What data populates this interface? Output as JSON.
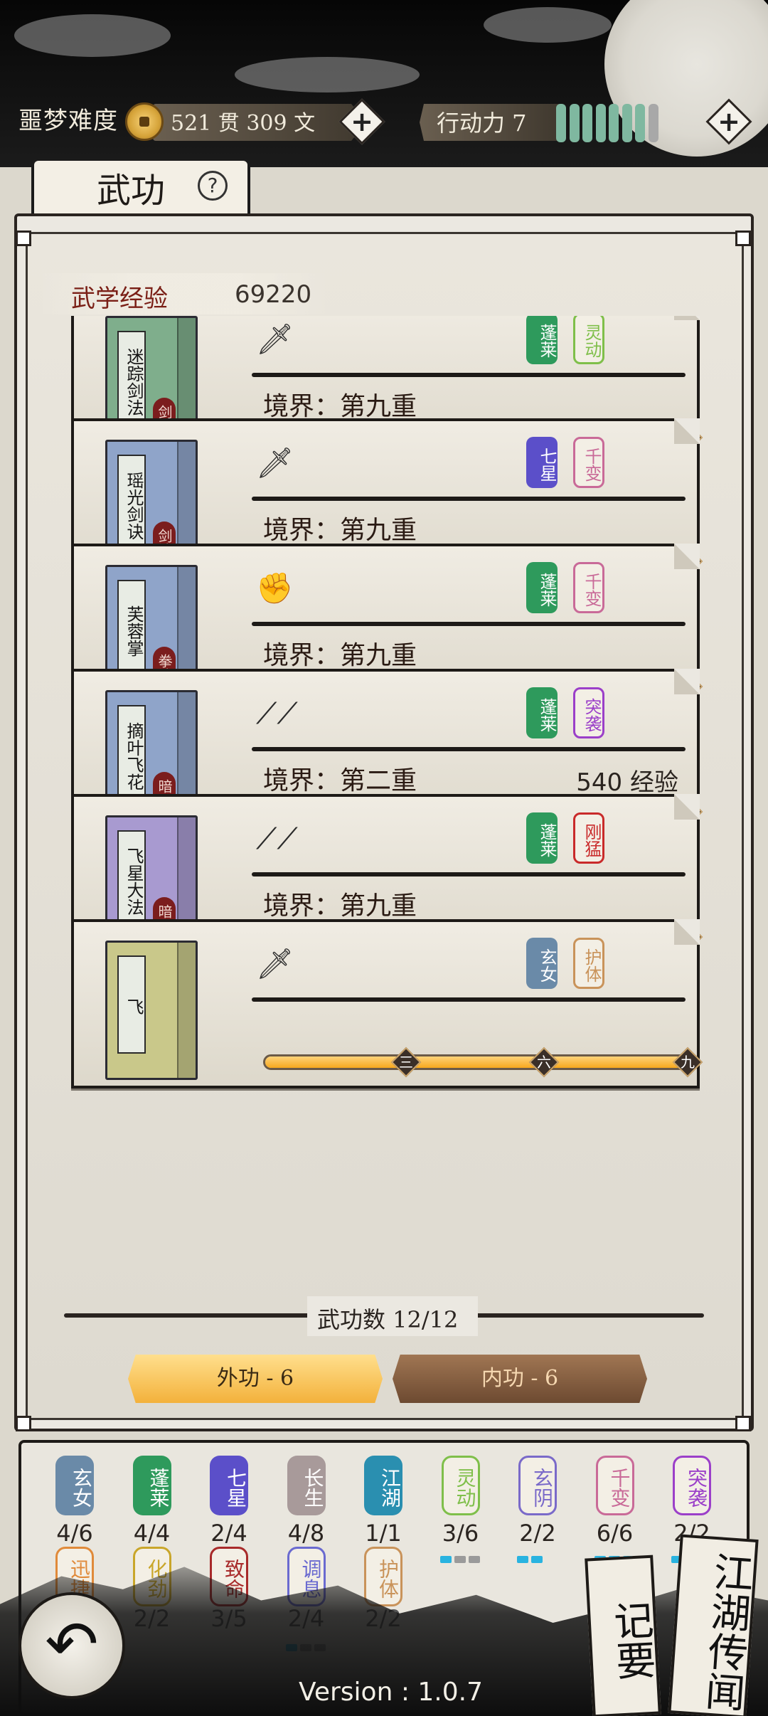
{
  "header": {
    "difficulty": "噩梦难度",
    "money": "521  贯   309   文",
    "action_label": "行动力 7",
    "action_points": 7,
    "action_max": 8
  },
  "panel": {
    "title": "武功",
    "help": "?",
    "exp_label": "武学经验",
    "exp_value": "69220"
  },
  "skills": [
    {
      "name": "迷踪剑法",
      "type": "剑法",
      "book_color": "#7fae8c",
      "weapon": "sword",
      "realm": "境界：第九重",
      "progress": 1.0,
      "tags": [
        {
          "text": "蓬莱",
          "color": "#2e9a5c",
          "outline": false
        },
        {
          "text": "灵动",
          "color": "#7fbf4a",
          "outline": true
        }
      ]
    },
    {
      "name": "瑶光剑诀",
      "type": "剑法",
      "book_color": "#8fa4c9",
      "weapon": "sword",
      "realm": "境界：第九重",
      "progress": 1.0,
      "tags": [
        {
          "text": "七星",
          "color": "#5b4fc9",
          "outline": false
        },
        {
          "text": "千变",
          "color": "#c96a98",
          "outline": true
        }
      ]
    },
    {
      "name": "芙蓉掌",
      "type": "拳法",
      "book_color": "#8fa4c9",
      "weapon": "fist",
      "realm": "境界：第九重",
      "progress": 1.0,
      "tags": [
        {
          "text": "蓬莱",
          "color": "#2e9a5c",
          "outline": false
        },
        {
          "text": "千变",
          "color": "#c96a98",
          "outline": true
        }
      ]
    },
    {
      "name": "摘叶飞花",
      "type": "暗器",
      "book_color": "#8fa4c9",
      "weapon": "dart",
      "realm": "境界：第二重",
      "exp_need": "540 经验",
      "progress": 0.22,
      "tags": [
        {
          "text": "蓬莱",
          "color": "#2e9a5c",
          "outline": false
        },
        {
          "text": "突袭",
          "color": "#9b3fc9",
          "outline": true
        }
      ]
    },
    {
      "name": "飞星大法",
      "type": "暗器",
      "book_color": "#a89ad0",
      "weapon": "dart",
      "realm": "境界：第九重",
      "progress": 1.0,
      "tags": [
        {
          "text": "蓬莱",
          "color": "#2e9a5c",
          "outline": false
        },
        {
          "text": "刚猛",
          "color": "#c92a2a",
          "outline": true
        }
      ]
    },
    {
      "name": "飞",
      "type": "",
      "book_color": "#c9c88a",
      "weapon": "sword",
      "realm": "",
      "progress": 1.0,
      "tags": [
        {
          "text": "玄女",
          "color": "#6a8aa8",
          "outline": false
        },
        {
          "text": "护体",
          "color": "#c9935a",
          "outline": true
        }
      ]
    }
  ],
  "tier_marks": [
    "三",
    "六",
    "九"
  ],
  "footer": {
    "count": "武功数 12/12",
    "outer_tab": "外功 - 6",
    "inner_tab": "内功 - 6"
  },
  "bonuses": [
    {
      "name": "玄女",
      "count": "4/6",
      "color": "#6a8aa8",
      "outline": false
    },
    {
      "name": "蓬莱",
      "count": "4/4",
      "color": "#2e9a5c",
      "outline": false
    },
    {
      "name": "七星",
      "count": "2/4",
      "color": "#5b4fc9",
      "outline": false
    },
    {
      "name": "长生",
      "count": "4/8",
      "color": "#a89a9a",
      "outline": false
    },
    {
      "name": "江湖",
      "count": "1/1",
      "color": "#2a8fb0",
      "outline": false
    },
    {
      "name": "灵动",
      "count": "3/6",
      "color": "#7fbf4a",
      "outline": true,
      "dots": [
        1,
        0,
        0
      ]
    },
    {
      "name": "玄阴",
      "count": "2/2",
      "color": "#7a6ac9",
      "outline": true,
      "dots": [
        1,
        1
      ]
    },
    {
      "name": "千变",
      "count": "6/6",
      "color": "#c96a98",
      "outline": true,
      "dots": [
        1,
        1,
        1
      ]
    },
    {
      "name": "突袭",
      "count": "2/2",
      "color": "#9b3fc9",
      "outline": true,
      "dots": [
        1,
        1
      ]
    },
    {
      "name": "迅捷",
      "count": "",
      "color": "#e08a3a",
      "outline": true
    },
    {
      "name": "化劲",
      "count": "2/2",
      "color": "#c9a62a",
      "outline": true
    },
    {
      "name": "致命",
      "count": "3/5",
      "color": "#a82a2a",
      "outline": true
    },
    {
      "name": "调息",
      "count": "2/4",
      "color": "#6a6ad0",
      "outline": true,
      "dots": [
        1,
        0,
        0
      ]
    },
    {
      "name": "护体",
      "count": "2/2",
      "color": "#c9935a",
      "outline": true
    }
  ],
  "buttons": {
    "notes": "记要",
    "rumors": "江湖传闻"
  },
  "version": "Version : 1.0.7"
}
